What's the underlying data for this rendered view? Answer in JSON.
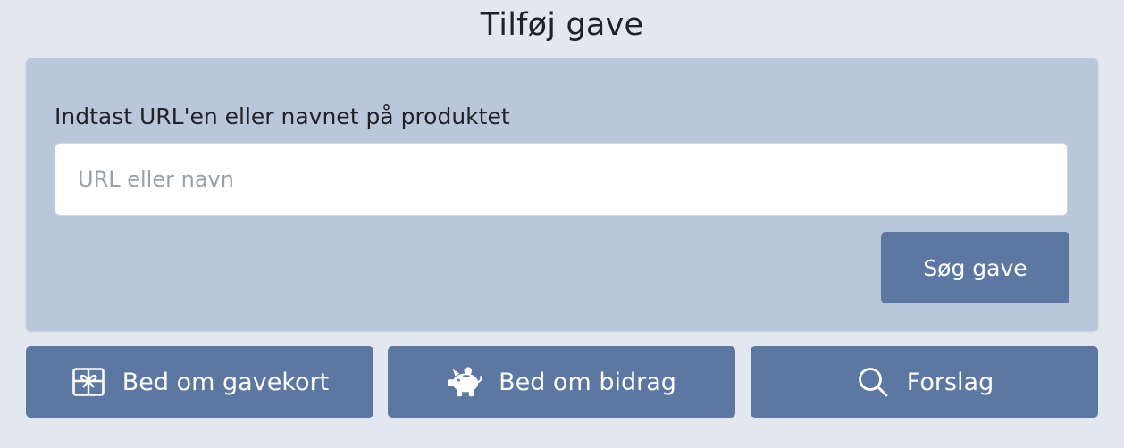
{
  "page": {
    "title": "Tilføj gave"
  },
  "form": {
    "label": "Indtast URL'en eller navnet på produktet",
    "input_value": "",
    "input_placeholder": "URL eller navn",
    "search_label": "Søg gave"
  },
  "actions": [
    {
      "label": "Bed om gavekort",
      "icon": "gift-card-icon"
    },
    {
      "label": "Bed om bidrag",
      "icon": "piggy-bank-icon"
    },
    {
      "label": "Forslag",
      "icon": "search-icon"
    }
  ],
  "colors": {
    "background": "#e3e8f0",
    "panel": "#bac6da",
    "button": "#5d77a3",
    "button_text": "#ffffff",
    "input_background": "#ffffff",
    "placeholder": "#9aa0a8"
  }
}
